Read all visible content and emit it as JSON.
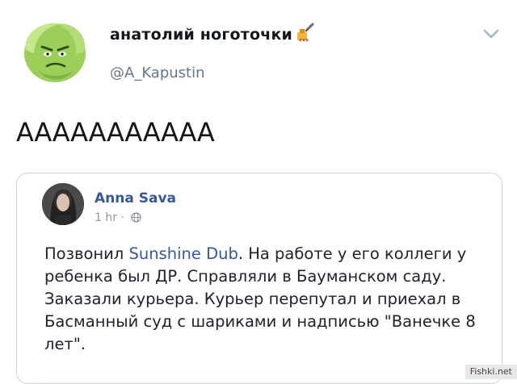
{
  "tweet": {
    "display_name": "анатолий ноготочки",
    "handle": "@A_Kapustin",
    "text": "ААААААААААА",
    "avatar_icon": "cabbage-avatar-icon",
    "name_emoji_icon": "nail-polish-icon",
    "menu_icon": "chevron-down-icon"
  },
  "quoted_post": {
    "author": "Anna Sava",
    "time": "1 hr",
    "separator": "·",
    "privacy_icon": "globe-icon",
    "body_prefix": "Позвонил ",
    "mention": "Sunshine Dub",
    "body_suffix": ". На работе у его коллеги у ребенка был ДР. Справляли в Бауманском саду. Заказали курьера. Курьер перепутал и приехал в Басманный суд с шариками и надписью \"Ванечке 8 лет\"."
  },
  "watermark": "Fishki.net",
  "colors": {
    "text": "#14171a",
    "muted": "#657786",
    "fb_link": "#365899",
    "card_border": "#ccd6dd"
  }
}
